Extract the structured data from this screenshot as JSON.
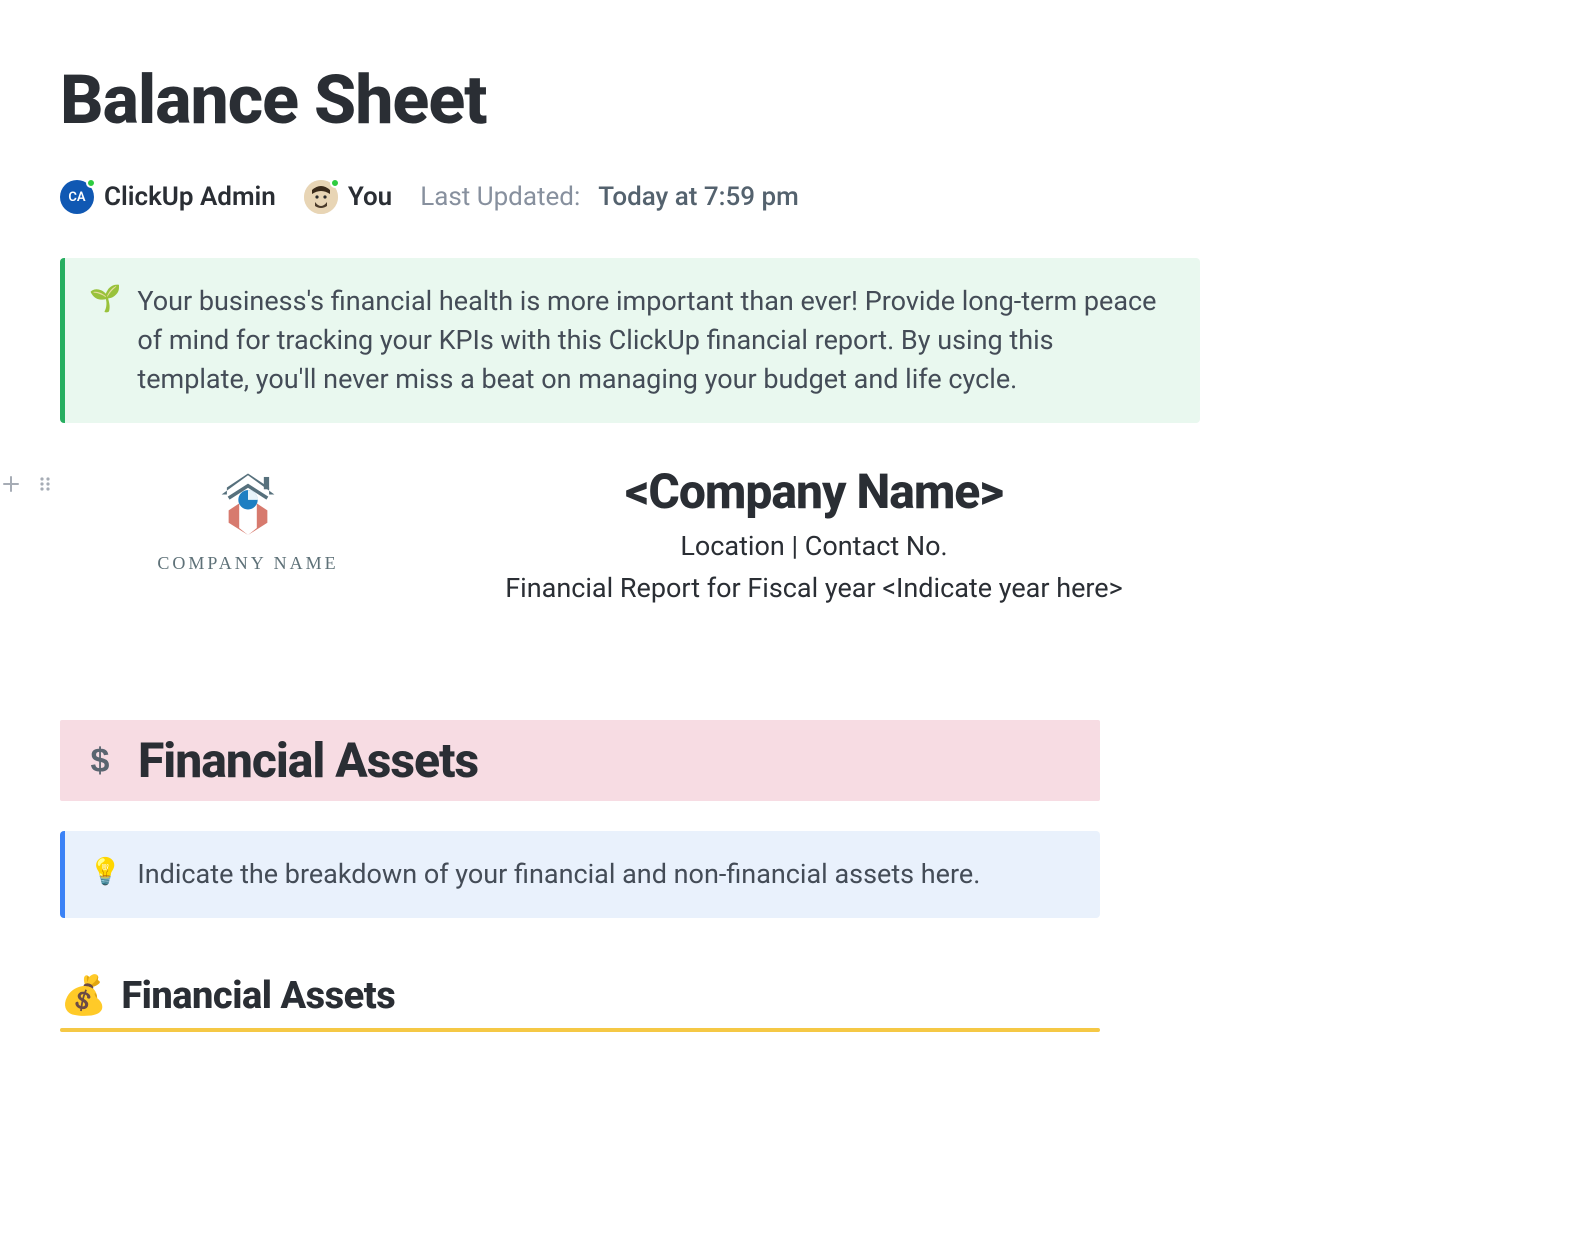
{
  "page_title": "Balance Sheet",
  "users": {
    "admin": {
      "initials": "CA",
      "name": "ClickUp Admin"
    },
    "you": {
      "name": "You"
    }
  },
  "last_updated": {
    "label": "Last Updated:",
    "value": "Today at 7:59 pm"
  },
  "intro_callout": {
    "icon": "🌱",
    "text": "Your business's financial health is more important than ever! Provide long-term peace of mind for tracking your KPIs with this ClickUp financial report. By using this template, you'll never miss a beat on managing your budget and life cycle."
  },
  "logo_caption": "COMPANY NAME",
  "company": {
    "name": "<Company Name>",
    "location_line": "Location | Contact No.",
    "report_line": "Financial Report for Fiscal year <Indicate year here>"
  },
  "financial_assets_section": {
    "title": "Financial Assets"
  },
  "breakdown_callout": {
    "icon": "💡",
    "text": "Indicate the breakdown of your financial and non-financial assets here."
  },
  "sub_financial_assets": {
    "icon": "💰",
    "title": "Financial Assets"
  }
}
